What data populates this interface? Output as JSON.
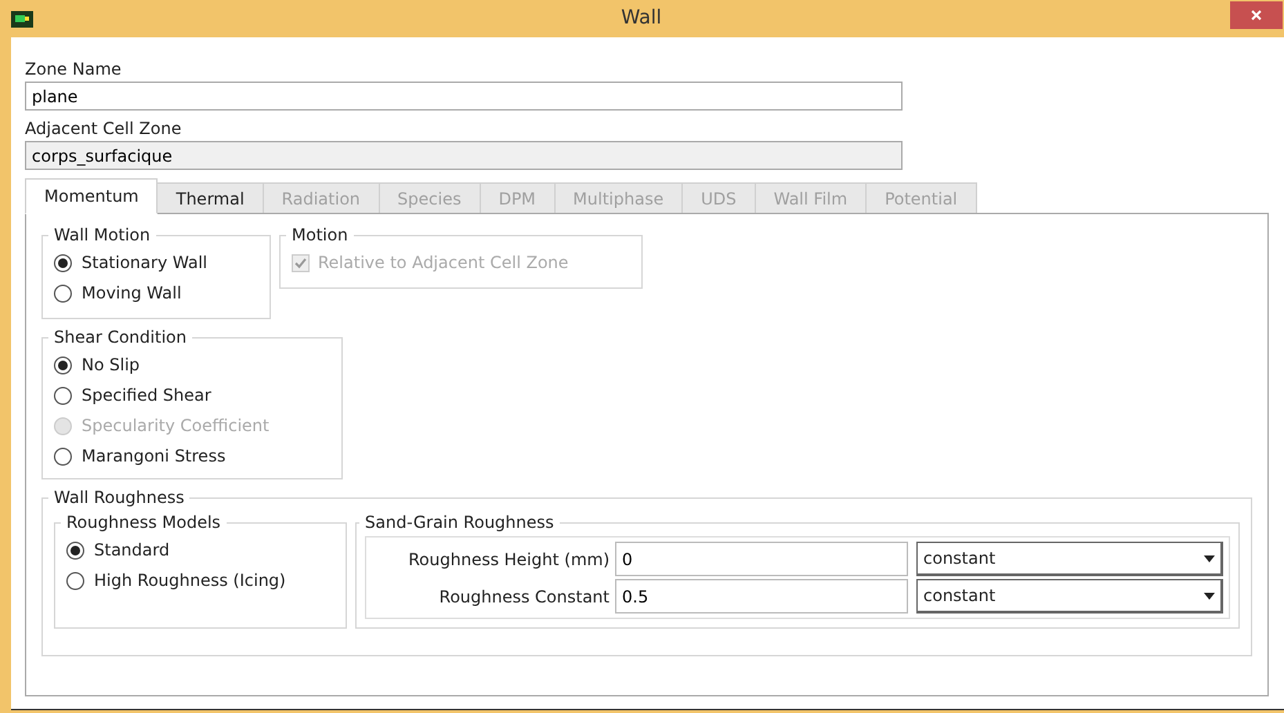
{
  "window": {
    "title": "Wall"
  },
  "zone_name": {
    "label": "Zone Name",
    "value": "plane"
  },
  "adjacent_cell_zone": {
    "label": "Adjacent Cell Zone",
    "value": "corps_surfacique"
  },
  "tabs": [
    {
      "label": "Momentum",
      "selected": true,
      "disabled": false
    },
    {
      "label": "Thermal",
      "selected": false,
      "disabled": false
    },
    {
      "label": "Radiation",
      "selected": false,
      "disabled": true
    },
    {
      "label": "Species",
      "selected": false,
      "disabled": true
    },
    {
      "label": "DPM",
      "selected": false,
      "disabled": true
    },
    {
      "label": "Multiphase",
      "selected": false,
      "disabled": true
    },
    {
      "label": "UDS",
      "selected": false,
      "disabled": true
    },
    {
      "label": "Wall Film",
      "selected": false,
      "disabled": true
    },
    {
      "label": "Potential",
      "selected": false,
      "disabled": true
    }
  ],
  "wall_motion": {
    "title": "Wall Motion",
    "options": [
      {
        "label": "Stationary Wall",
        "selected": true,
        "disabled": false
      },
      {
        "label": "Moving Wall",
        "selected": false,
        "disabled": false
      }
    ]
  },
  "motion": {
    "title": "Motion",
    "checkbox": {
      "label": "Relative to Adjacent Cell Zone",
      "checked": true,
      "disabled": true
    }
  },
  "shear_condition": {
    "title": "Shear Condition",
    "options": [
      {
        "label": "No Slip",
        "selected": true,
        "disabled": false
      },
      {
        "label": "Specified Shear",
        "selected": false,
        "disabled": false
      },
      {
        "label": "Specularity Coefficient",
        "selected": false,
        "disabled": true
      },
      {
        "label": "Marangoni Stress",
        "selected": false,
        "disabled": false
      }
    ]
  },
  "wall_roughness": {
    "title": "Wall Roughness",
    "roughness_models": {
      "title": "Roughness Models",
      "options": [
        {
          "label": "Standard",
          "selected": true,
          "disabled": false
        },
        {
          "label": "High Roughness (Icing)",
          "selected": false,
          "disabled": false
        }
      ]
    },
    "sand_grain": {
      "title": "Sand-Grain Roughness",
      "rows": [
        {
          "label": "Roughness Height (mm)",
          "value": "0",
          "method": "constant"
        },
        {
          "label": "Roughness Constant",
          "value": "0.5",
          "method": "constant"
        }
      ]
    }
  }
}
